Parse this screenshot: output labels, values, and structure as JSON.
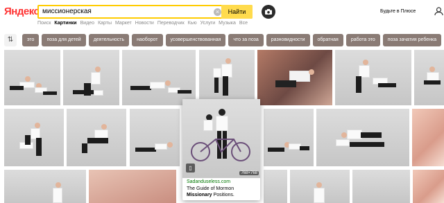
{
  "header": {
    "logo_text": "Яндекс",
    "search": {
      "value": "миссионерская",
      "clear_icon": "close-icon",
      "find_label": "Найти",
      "camera_icon": "camera-icon"
    },
    "promo_label": "Будьте в Плюсе",
    "promo_icon": "plus-icon",
    "login_icon": "user-icon"
  },
  "nav": [
    "Поиск",
    "Картинки",
    "Видео",
    "Карты",
    "Маркет",
    "Новости",
    "Переводчик",
    "Кью",
    "Услуги",
    "Музыка",
    "Все"
  ],
  "nav_active_index": 1,
  "filters": {
    "settings_icon": "sliders-icon",
    "chips": [
      "это",
      "поза для детей",
      "деятельность",
      "наоборот",
      "усовершенствованная",
      "что за поза",
      "разновидности",
      "обратная",
      "работа это",
      "поза зачатия ребенка"
    ],
    "chip_color": "#8a7b75"
  },
  "preview": {
    "dimensions": "768×768",
    "source": "Sadanduseless.com",
    "title_before": "The Guide of Mormon ",
    "title_bold": "Missionary",
    "title_after": " Positions.",
    "bookmark_icon": "bookmark-icon"
  }
}
